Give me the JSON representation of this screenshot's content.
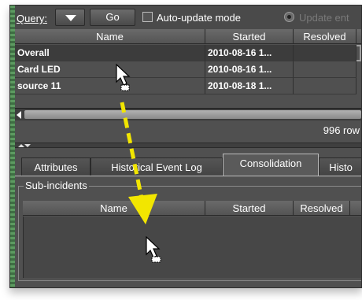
{
  "toolbar": {
    "query_label": "Query:",
    "go_label": "Go",
    "auto_update_label": "Auto-update mode",
    "update_label": "Update ent"
  },
  "table": {
    "columns": [
      "Name",
      "Started",
      "Resolved"
    ],
    "rows": [
      {
        "name": "Overall",
        "started": "2010-08-16 1...",
        "resolved": ""
      },
      {
        "name": "Card LED",
        "started": "2010-08-16 1...",
        "resolved": ""
      },
      {
        "name": "source 11",
        "started": "2010-08-18 1...",
        "resolved": ""
      }
    ],
    "row_count": "996 row"
  },
  "tabs": [
    {
      "label": "Attributes"
    },
    {
      "label": "Historical Event Log"
    },
    {
      "label": "Consolidation"
    },
    {
      "label": "Histo"
    }
  ],
  "sub_incidents": {
    "group_label": "Sub-incidents",
    "columns": [
      "Name",
      "Started",
      "Resolved"
    ]
  },
  "colors": {
    "accent_arrow": "#f2e600",
    "panel_bg": "#505050"
  }
}
